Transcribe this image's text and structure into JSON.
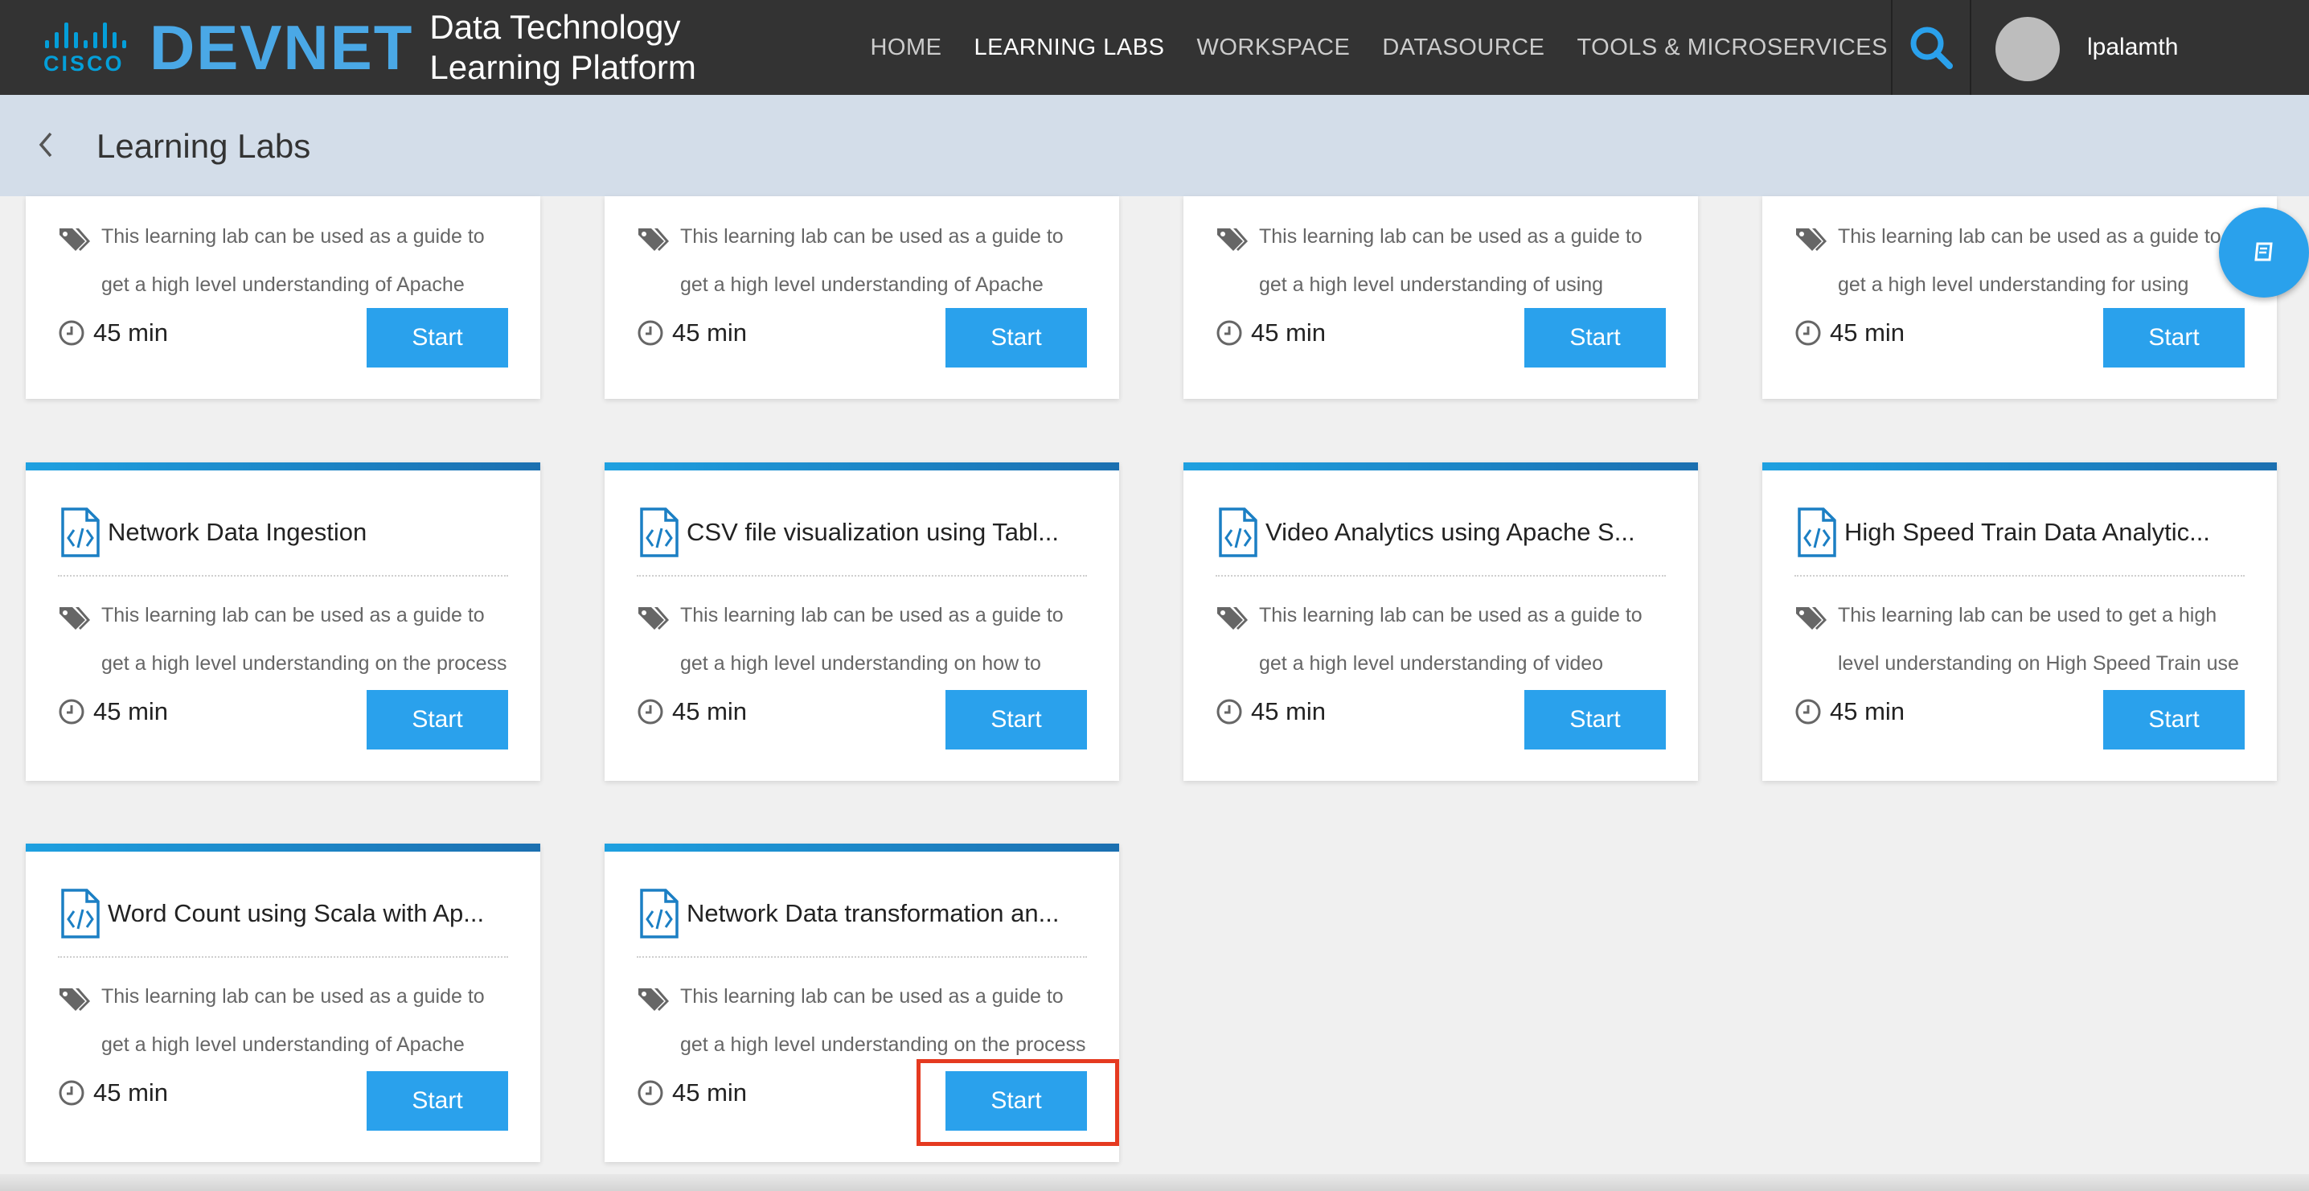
{
  "brand": {
    "cisco": "CISCO",
    "devnet": "DEVNET",
    "platform_line1": "Data Technology",
    "platform_line2": "Learning Platform"
  },
  "nav": {
    "items": [
      {
        "label": "HOME",
        "active": false
      },
      {
        "label": "LEARNING LABS",
        "active": true
      },
      {
        "label": "WORKSPACE",
        "active": false
      },
      {
        "label": "DATASOURCE",
        "active": false
      },
      {
        "label": "TOOLS & MICROSERVICES",
        "active": false
      }
    ],
    "search_icon": "search-icon",
    "username": "lpalamth"
  },
  "subheader": {
    "title": "Learning Labs",
    "back_icon": "chevron-left-icon"
  },
  "colors": {
    "topbar": "#333333",
    "accent": "#2aa1ec",
    "subheader": "#d3dde9",
    "highlight": "#e53a20"
  },
  "cards": [
    {
      "title": "",
      "desc": "This learning lab can be used as a guide to get a high level understanding of Apache Spark",
      "duration": "45 min",
      "button": "Start"
    },
    {
      "title": "",
      "desc": "This learning lab can be used as a guide to get a high level understanding of Apache Hadoop.",
      "duration": "45 min",
      "button": "Start"
    },
    {
      "title": "",
      "desc": "This learning lab can be used as a guide to get a high level understanding of using Python with",
      "duration": "45 min",
      "button": "Start"
    },
    {
      "title": "",
      "desc": "This learning lab can be used as a guide to get a high level understanding for using",
      "duration": "45 min",
      "button": "Start"
    },
    {
      "title": "Network Data Ingestion",
      "desc": "This learning lab can be used as a guide to get a high level understanding on the process of",
      "duration": "45 min",
      "button": "Start"
    },
    {
      "title": "CSV file visualization using Tabl...",
      "desc": "This learning lab can be used as a guide to get a high level understanding on how to visualise",
      "duration": "45 min",
      "button": "Start"
    },
    {
      "title": "Video Analytics using Apache S...",
      "desc": "This learning lab can be used as a guide to get a high level understanding of video analytics",
      "duration": "45 min",
      "button": "Start"
    },
    {
      "title": "High Speed Train Data Analytic...",
      "desc": "This learning lab can be used to get a high level understanding on High Speed Train use",
      "duration": "45 min",
      "button": "Start"
    },
    {
      "title": "Word Count using Scala with Ap...",
      "desc": "This learning lab can be used as a guide to get a high level understanding of Apache Spark",
      "duration": "45 min",
      "button": "Start"
    },
    {
      "title": "Network Data transformation an...",
      "desc": "This learning lab can be used as a guide to get a high level understanding on the process of",
      "duration": "45 min",
      "button": "Start"
    }
  ]
}
